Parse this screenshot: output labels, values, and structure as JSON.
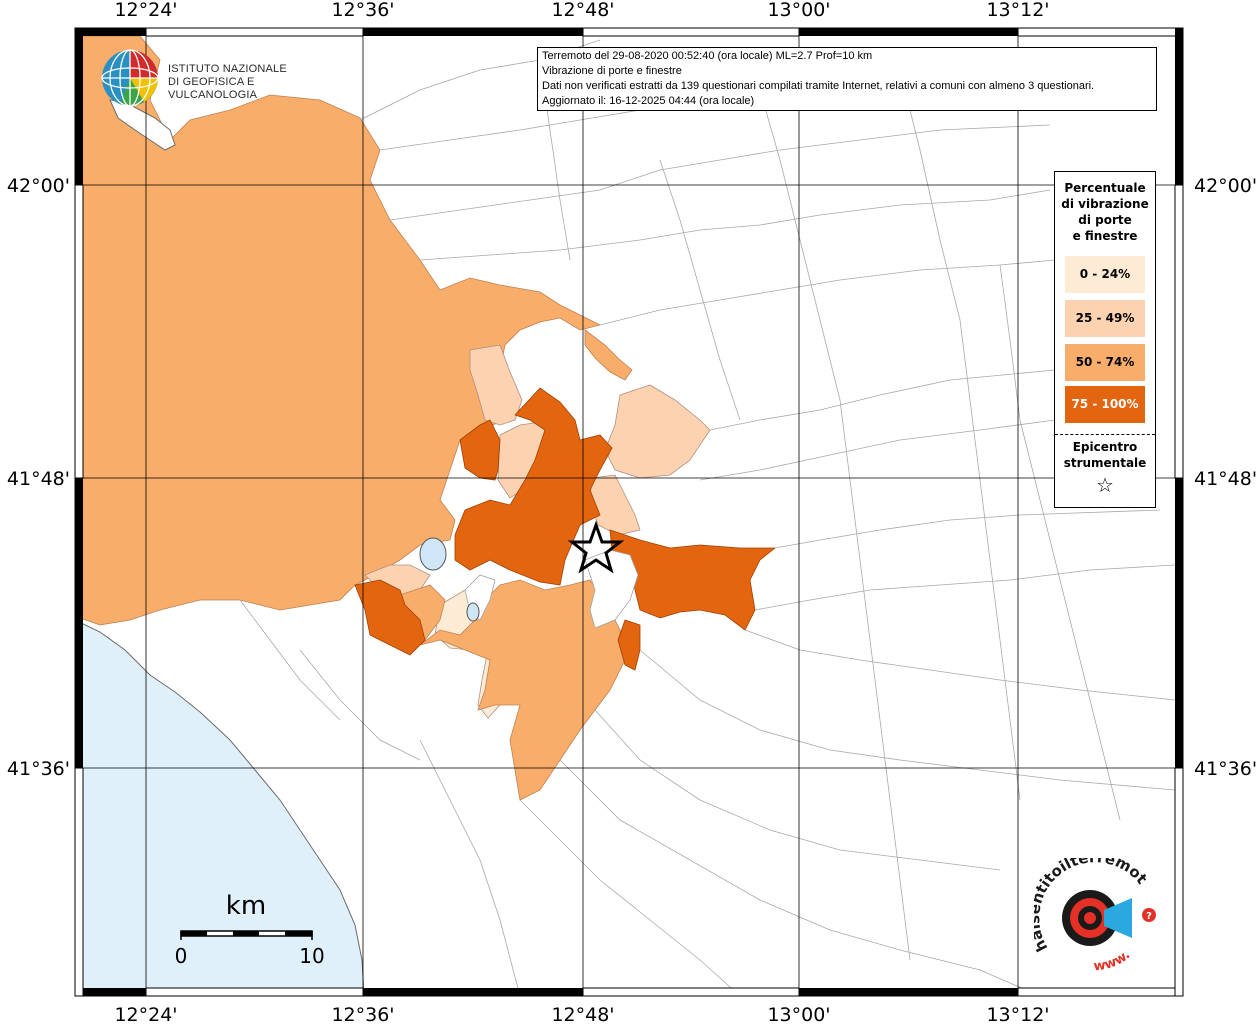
{
  "map": {
    "lon_labels": [
      "12°24'",
      "12°36'",
      "12°48'",
      "13°00'",
      "13°12'"
    ],
    "lat_labels": [
      "42°00'",
      "41°48'",
      "41°36'"
    ]
  },
  "info": {
    "line1": "Terremoto del 29-08-2020 00:52:40 (ora locale) ML=2.7 Prof=10 km",
    "line2": "Vibrazione di porte e finestre",
    "line3": "Dati non verificati estratti da 139 questionari compilati tramite Internet, relativi a comuni con almeno 3 questionari.",
    "line4": "Aggiornato il: 16-12-2025 04:44 (ora locale)"
  },
  "legend": {
    "title_lines": [
      "Percentuale",
      "di vibrazione",
      "di porte",
      "e finestre"
    ],
    "classes": [
      {
        "label": "0 - 24%",
        "color": "#fdebd6",
        "text_color": "#000000"
      },
      {
        "label": "25 - 49%",
        "color": "#fcd2b0",
        "text_color": "#000000"
      },
      {
        "label": "50 - 74%",
        "color": "#f8ad6b",
        "text_color": "#000000"
      },
      {
        "label": "75 - 100%",
        "color": "#e36510",
        "text_color": "#ffffff"
      }
    ],
    "epicenter_lines": [
      "Epicentro",
      "strumentale"
    ],
    "star": "☆"
  },
  "scale": {
    "unit": "km",
    "min_label": "0",
    "max_label": "10"
  },
  "logos": {
    "ingv_line1": "ISTITUTO NAZIONALE",
    "ingv_line2": "DI GEOFISICA E VULCANOLOGIA",
    "hsit_top": "haisentitoilterremoto.it",
    "hsit_bottom": "www."
  },
  "colors": {
    "sea": "#e0f0fb",
    "c0": "#fdebd6",
    "c1": "#fcd2b0",
    "c2": "#f8ad6b",
    "c3": "#e36510",
    "border": "#a0a0a0"
  }
}
